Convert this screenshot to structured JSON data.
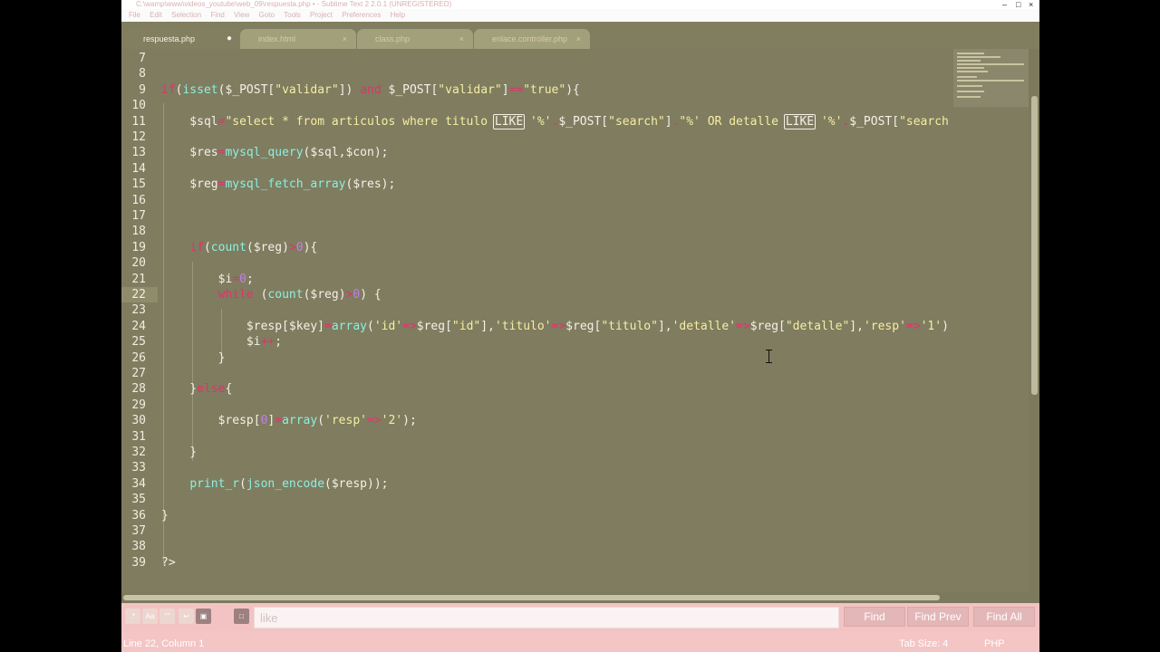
{
  "window": {
    "title": "C:\\wamp\\www\\videos_youtube\\web_09\\respuesta.php • - Sublime Text 2 2.0.1 (UNREGISTERED)",
    "menu": [
      "File",
      "Edit",
      "Selection",
      "Find",
      "View",
      "Goto",
      "Tools",
      "Project",
      "Preferences",
      "Help"
    ]
  },
  "tabs": [
    {
      "label": "respuesta.php",
      "close": "●"
    },
    {
      "label": "index.html",
      "close": "×"
    },
    {
      "label": "class.php",
      "close": "×"
    },
    {
      "label": "enlace.controller.php",
      "close": "×"
    }
  ],
  "editor": {
    "current_line": "22",
    "lines": [
      {
        "n": "7"
      },
      {
        "n": "8"
      },
      {
        "n": "9"
      },
      {
        "n": "10"
      },
      {
        "n": "11"
      },
      {
        "n": "12"
      },
      {
        "n": "13"
      },
      {
        "n": "14"
      },
      {
        "n": "15"
      },
      {
        "n": "16"
      },
      {
        "n": "17"
      },
      {
        "n": "18"
      },
      {
        "n": "19"
      },
      {
        "n": "20"
      },
      {
        "n": "21"
      },
      {
        "n": "22"
      },
      {
        "n": "23"
      },
      {
        "n": "24"
      },
      {
        "n": "25"
      },
      {
        "n": "26"
      },
      {
        "n": "27"
      },
      {
        "n": "28"
      },
      {
        "n": "29"
      },
      {
        "n": "30"
      },
      {
        "n": "31"
      },
      {
        "n": "32"
      },
      {
        "n": "33"
      },
      {
        "n": "34"
      },
      {
        "n": "35"
      },
      {
        "n": "36"
      },
      {
        "n": "37"
      },
      {
        "n": "38"
      },
      {
        "n": "39"
      }
    ],
    "code": {
      "l9": [
        [
          "kw",
          "if"
        ],
        [
          "",
          "("
        ],
        [
          "fn",
          "isset"
        ],
        [
          "",
          "($_POST["
        ],
        [
          "str",
          "\"validar\""
        ],
        [
          "",
          "]) "
        ],
        [
          "kw",
          "and"
        ],
        [
          "",
          " $_POST["
        ],
        [
          "str",
          "\"validar\""
        ],
        [
          "",
          "]"
        ],
        [
          "kw",
          "=="
        ],
        [
          "str",
          "\"true\""
        ],
        [
          "",
          "){"
        ]
      ],
      "l11": [
        [
          "",
          "    $sql"
        ],
        [
          "kw",
          "="
        ],
        [
          "str",
          "\"select * from articulos where titulo "
        ],
        [
          "hl",
          "LIKE"
        ],
        [
          "str",
          " '%'"
        ],
        [
          "kw",
          "."
        ],
        [
          "",
          "$_POST["
        ],
        [
          "str",
          "\"search\""
        ],
        [
          "",
          "]"
        ],
        [
          "kw",
          "."
        ],
        [
          "str",
          "\"%' OR detalle "
        ],
        [
          "hl",
          "LIKE"
        ],
        [
          "str",
          " '%'"
        ],
        [
          "kw",
          "."
        ],
        [
          "",
          "$_POST["
        ],
        [
          "str",
          "\"search"
        ]
      ],
      "l13": [
        [
          "",
          "    $res"
        ],
        [
          "kw",
          "="
        ],
        [
          "fn",
          "mysql_query"
        ],
        [
          "",
          "($sql,$con);"
        ]
      ],
      "l15": [
        [
          "",
          "    $reg"
        ],
        [
          "kw",
          "="
        ],
        [
          "fn",
          "mysql_fetch_array"
        ],
        [
          "",
          "($res);"
        ]
      ],
      "l19": [
        [
          "",
          "    "
        ],
        [
          "kw",
          "if"
        ],
        [
          "",
          "("
        ],
        [
          "fn",
          "count"
        ],
        [
          "",
          "($reg)"
        ],
        [
          "kw",
          ">"
        ],
        [
          "num",
          "0"
        ],
        [
          "",
          "){"
        ]
      ],
      "l21": [
        [
          "",
          "        $i"
        ],
        [
          "kw",
          "="
        ],
        [
          "num",
          "0"
        ],
        [
          "",
          ";"
        ]
      ],
      "l22": [
        [
          "",
          "        "
        ],
        [
          "kw",
          "while"
        ],
        [
          "",
          " ("
        ],
        [
          "fn",
          "count"
        ],
        [
          "",
          "($reg)"
        ],
        [
          "kw",
          ">"
        ],
        [
          "num",
          "0"
        ],
        [
          "",
          ") {"
        ]
      ],
      "l24": [
        [
          "",
          "            $resp[$key]"
        ],
        [
          "kw",
          "="
        ],
        [
          "fn",
          "array"
        ],
        [
          "",
          "("
        ],
        [
          "str",
          "'id'"
        ],
        [
          "kw",
          "=>"
        ],
        [
          "",
          "$reg["
        ],
        [
          "str",
          "\"id\""
        ],
        [
          "",
          "],"
        ],
        [
          "str",
          "'titulo'"
        ],
        [
          "kw",
          "=>"
        ],
        [
          "",
          "$reg["
        ],
        [
          "str",
          "\"titulo\""
        ],
        [
          "",
          "],"
        ],
        [
          "str",
          "'detalle'"
        ],
        [
          "kw",
          "=>"
        ],
        [
          "",
          "$reg["
        ],
        [
          "str",
          "\"detalle\""
        ],
        [
          "",
          "],"
        ],
        [
          "str",
          "'resp'"
        ],
        [
          "kw",
          "=>"
        ],
        [
          "str",
          "'1'"
        ],
        [
          "",
          ")"
        ]
      ],
      "l25": [
        [
          "",
          "            $i"
        ],
        [
          "kw",
          "++"
        ],
        [
          "",
          ";"
        ]
      ],
      "l26": [
        [
          "",
          "        }"
        ]
      ],
      "l28": [
        [
          "",
          "    }"
        ],
        [
          "kw",
          "else"
        ],
        [
          "",
          "{"
        ]
      ],
      "l30": [
        [
          "",
          "        $resp["
        ],
        [
          "num",
          "0"
        ],
        [
          "",
          "]"
        ],
        [
          "kw",
          "="
        ],
        [
          "fn",
          "array"
        ],
        [
          "",
          "("
        ],
        [
          "str",
          "'resp'"
        ],
        [
          "kw",
          "=>"
        ],
        [
          "str",
          "'2'"
        ],
        [
          "",
          ");"
        ]
      ],
      "l32": [
        [
          "",
          "    }"
        ]
      ],
      "l34": [
        [
          "",
          "    "
        ],
        [
          "fn",
          "print_r"
        ],
        [
          "",
          "("
        ],
        [
          "fn",
          "json_encode"
        ],
        [
          "",
          "($resp));"
        ]
      ],
      "l36": [
        [
          "",
          "}"
        ]
      ],
      "l39": [
        [
          "",
          "?>"
        ]
      ]
    }
  },
  "find": {
    "value": "like",
    "find_label": "Find",
    "find_prev_label": "Find Prev",
    "find_all_label": "Find All"
  },
  "status": {
    "left": "Line 22, Column 1",
    "tab_size": "Tab Size: 4",
    "syntax": "PHP"
  },
  "colors": {
    "editor_bg": "#7f7c60",
    "keyword": "#e0336a",
    "function": "#8bf0df",
    "string": "#f6eea0",
    "number": "#c27fea",
    "text": "#f4f1e6"
  }
}
